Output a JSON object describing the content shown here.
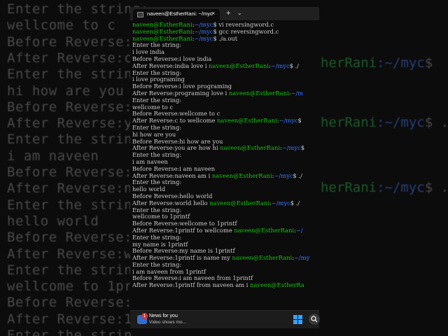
{
  "window": {
    "tab_title": "naveen@EstherRani: ~/myc",
    "tab_close": "×",
    "new_tab": "+",
    "tab_menu": "⌄"
  },
  "prompt": {
    "user": "naveen@EstherRani",
    "path": "~/myc",
    "symbol": "$"
  },
  "terminal": [
    {
      "user": "naveen@EstherRani",
      "sep": ":",
      "path": "~/myc",
      "text": "$ vi  reversingword.c"
    },
    {
      "user": "naveen@EstherRani",
      "sep": ":",
      "path": "~/myc",
      "text": "$ gcc reversingword.c"
    },
    {
      "user": "naveen@EstherRani",
      "sep": ":",
      "path": "~/myc",
      "text": "$ ./a.out"
    },
    {
      "text": "Enter the string:"
    },
    {
      "text": "i love india"
    },
    {
      "text": "Before Reverse:i love india"
    },
    {
      "text": "After Reverse:india love i ",
      "user": "naveen@EstherRani",
      "sep": ":",
      "path": "~/myc",
      "tail": "$ ./"
    },
    {
      "text": "Enter the string:"
    },
    {
      "text": "i love programing"
    },
    {
      "text": "Before Reverse:i love programing"
    },
    {
      "text": "After Reverse:programing love i ",
      "user": "naveen@EstherRani",
      "sep": ":",
      "path": "~/m",
      "tail": ""
    },
    {
      "text": "Enter the string:"
    },
    {
      "text": "wellcome to c"
    },
    {
      "text": "Before Reverse:wellcome to c"
    },
    {
      "text": "After Reverse:c to wellcome ",
      "user": "naveen@EstherRani",
      "sep": ":",
      "path": "~/myc",
      "tail": "$"
    },
    {
      "text": "Enter the string:"
    },
    {
      "text": "hi how are you"
    },
    {
      "text": "Before Reverse:hi how are you"
    },
    {
      "text": "After Reverse:you are how hi ",
      "user": "naveen@EstherRani",
      "sep": ":",
      "path": "~/myc",
      "tail": "$"
    },
    {
      "text": "Enter the string:"
    },
    {
      "text": "i am naveen"
    },
    {
      "text": "Before Reverse:i am naveen"
    },
    {
      "text": "After Reverse:naveen am i ",
      "user": "naveen@EstherRani",
      "sep": ":",
      "path": "~/myc",
      "tail": "$ ./"
    },
    {
      "text": "Enter the string:"
    },
    {
      "text": "hello world"
    },
    {
      "text": "Before Reverse:hello world"
    },
    {
      "text": "After Reverse:world hello ",
      "user": "naveen@EstherRani",
      "sep": ":",
      "path": "~/myc",
      "tail": "$ ./"
    },
    {
      "text": "Enter the string:"
    },
    {
      "text": "wellcome to 1printf"
    },
    {
      "text": "Before Reverse:wellcome to 1printf"
    },
    {
      "text": "After Reverse:1printf to wellcome ",
      "user": "naveen@EstherRani",
      "sep": ":",
      "path": "~/",
      "tail": ""
    },
    {
      "text": "Enter the string:"
    },
    {
      "text": "my name is 1printf"
    },
    {
      "text": "Before Reverse:my name is 1printf"
    },
    {
      "text": "After Reverse:1printf is name my ",
      "user": "naveen@EstherRani",
      "sep": ":",
      "path": "~/my",
      "tail": ""
    },
    {
      "text": "Enter the string:"
    },
    {
      "text": "i am naveen from 1printf"
    },
    {
      "text": "Before Reverse:i am naveen from 1printf"
    },
    {
      "text": "After Reverse:1printf from naveen am i ",
      "user": "naveen@EstherRa",
      "sep": "",
      "path": "",
      "tail": ""
    }
  ],
  "background": {
    "lines": [
      "Enter the string:",
      "wellcome to c",
      "Before Reverse:",
      "After Reverse:c",
      "Enter the strin",
      "hi how are you",
      "Before Reverse:",
      "After Reverse:y",
      "Enter the strin",
      "i am naveen",
      "Before Reverse:",
      "After Reverse:n",
      "Enter the strin",
      "hello world",
      "Before Reverse:",
      "After Reverse:w",
      "Enter the strin",
      "wellcome to 1pr",
      "Before Reverse:",
      "After Reverse:1",
      "Enter the strin"
    ],
    "right_fragments": [
      {
        "host": "herRani",
        "path": ":~/myc",
        "tail": "$"
      },
      {
        "host": "herRani",
        "path": ":~/myc",
        "tail": "$ ./"
      },
      {
        "host": "herRani",
        "path": ":~/myc",
        "tail": "$ ./a"
      }
    ]
  },
  "taskbar": {
    "news_title": "News for you",
    "news_subtitle": "Video shows mo...",
    "news_badge": "1"
  },
  "colors": {
    "user": "#16c60c",
    "path": "#3b78ff",
    "text": "#cccccc",
    "terminal_bg": "#0c0c0c"
  }
}
